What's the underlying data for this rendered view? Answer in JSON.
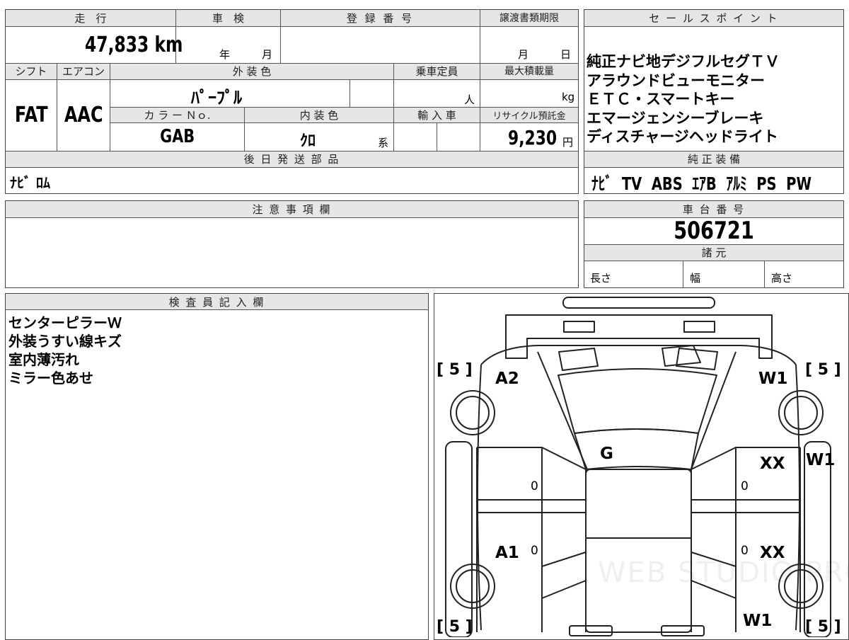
{
  "header_labels": {
    "mileage": "走　行",
    "inspection": "車　検",
    "registration_no": "登 録 番 号",
    "transfer_deadline": "譲渡書類期限",
    "sales_points": "セ ー ル ス ポ イ ン ト",
    "shift": "シフト",
    "aircon": "エアコン",
    "exterior_color": "外 装 色",
    "capacity": "乗車定員",
    "max_load": "最大積載量",
    "color_no": "カ ラ ー Ｎｏ.",
    "interior_color": "内 装 色",
    "import": "輸 入 車",
    "recycle_fee": "リサイクル預託金",
    "later_parts": "後 日 発 送 部 品",
    "standard_equipment": "純 正 装 備",
    "caution": "注 意 事 項 欄",
    "chassis_no": "車 台 番 号",
    "specs": "諸 元",
    "inspector_notes": "検 査 員 記 入 欄"
  },
  "vehicle": {
    "mileage": "47,833",
    "mileage_unit": "km",
    "inspection_year_unit": "年",
    "inspection_month_unit": "月",
    "deadline_month_unit": "月",
    "deadline_day_unit": "日",
    "shift": "FAT",
    "aircon": "AAC",
    "exterior_color": "ﾊﾟｰﾌﾟﾙ",
    "capacity_unit": "人",
    "max_load_unit": "kg",
    "color_no": "GAB",
    "interior_color": "ｸﾛ",
    "interior_color_suffix": "系",
    "recycle_fee": "9,230",
    "recycle_fee_unit": "円",
    "later_parts": "ﾅﾋﾞ ﾛﾑ",
    "chassis_no": "506721",
    "spec_length": "長さ",
    "spec_width": "幅",
    "spec_height": "高さ"
  },
  "sales_points": [
    "純正ナビ地デジフルセグＴＶ",
    "アラウンドビューモニター",
    "ＥＴＣ・スマートキー",
    "エマージェンシーブレーキ",
    "ディスチャージヘッドライト"
  ],
  "equipment": [
    "ﾅﾋﾞ",
    "TV",
    "ABS",
    "ｴｱB",
    "ｱﾙﾐ",
    "PS",
    "PW"
  ],
  "inspector_notes": [
    "センターピラーＷ",
    "外装うすい線キズ",
    "室内薄汚れ",
    "ミラー色あせ"
  ],
  "diagram": {
    "tire_front_left": "[ 5 ]",
    "tire_front_right": "[ 5 ]",
    "tire_rear_left": "[ 5 ]",
    "tire_rear_right": "[ 5 ]",
    "front_left_fender": "A2",
    "front_right_fender": "W1",
    "right_front_edge": "W1",
    "windshield": "G",
    "right_front_door": "XX",
    "right_rear_door": "XX",
    "left_rear_quarter": "A1",
    "right_rear_quarter": "W1",
    "door_mark_lf": "0",
    "door_mark_rf": "0",
    "door_mark_lr": "0",
    "door_mark_rr": "0"
  },
  "watermark": "WEB STUDIO PRO"
}
